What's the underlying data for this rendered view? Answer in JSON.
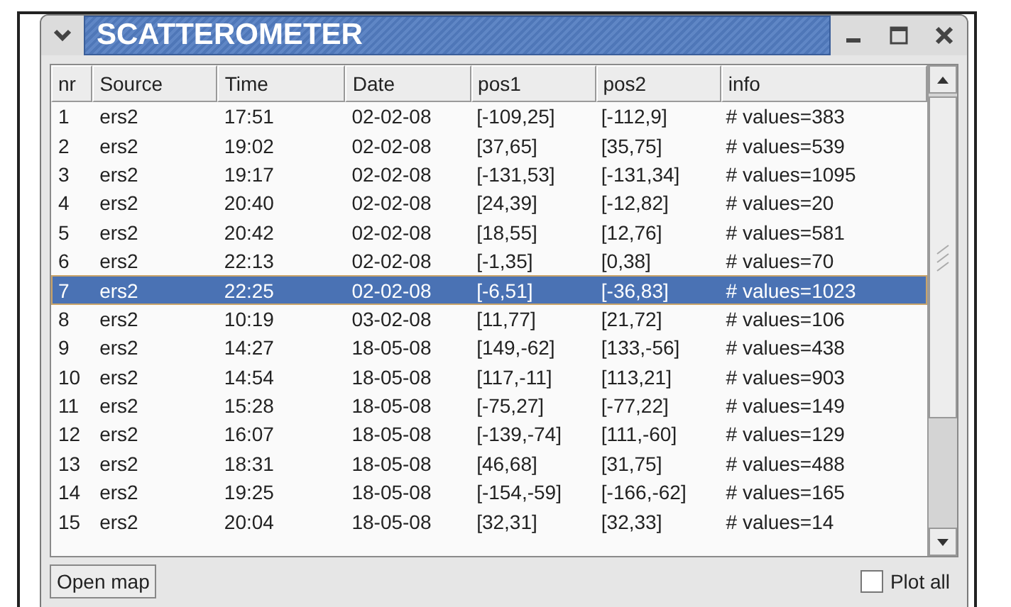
{
  "window": {
    "title": "SCATTEROMETER"
  },
  "table": {
    "columns": [
      "nr",
      "Source",
      "Time",
      "Date",
      "pos1",
      "pos2",
      "info"
    ],
    "rows": [
      {
        "cells": [
          "1",
          "ers2",
          "17:51",
          "02-02-08",
          "[-109,25]",
          "[-112,9]",
          "# values=383"
        ],
        "selected": false
      },
      {
        "cells": [
          "2",
          "ers2",
          "19:02",
          "02-02-08",
          "[37,65]",
          "[35,75]",
          "# values=539"
        ],
        "selected": false
      },
      {
        "cells": [
          "3",
          "ers2",
          "19:17",
          "02-02-08",
          "[-131,53]",
          "[-131,34]",
          "# values=1095"
        ],
        "selected": false
      },
      {
        "cells": [
          "4",
          "ers2",
          "20:40",
          "02-02-08",
          "[24,39]",
          "[-12,82]",
          "# values=20"
        ],
        "selected": false
      },
      {
        "cells": [
          "5",
          "ers2",
          "20:42",
          "02-02-08",
          "[18,55]",
          "[12,76]",
          "# values=581"
        ],
        "selected": false
      },
      {
        "cells": [
          "6",
          "ers2",
          "22:13",
          "02-02-08",
          "[-1,35]",
          "[0,38]",
          "# values=70"
        ],
        "selected": false
      },
      {
        "cells": [
          "7",
          "ers2",
          "22:25",
          "02-02-08",
          "[-6,51]",
          "[-36,83]",
          "# values=1023"
        ],
        "selected": true
      },
      {
        "cells": [
          "8",
          "ers2",
          "10:19",
          "03-02-08",
          "[11,77]",
          "[21,72]",
          "# values=106"
        ],
        "selected": false
      },
      {
        "cells": [
          "9",
          "ers2",
          "14:27",
          "18-05-08",
          "[149,-62]",
          "[133,-56]",
          "# values=438"
        ],
        "selected": false
      },
      {
        "cells": [
          "10",
          "ers2",
          "14:54",
          "18-05-08",
          "[117,-11]",
          "[113,21]",
          "# values=903"
        ],
        "selected": false
      },
      {
        "cells": [
          "11",
          "ers2",
          "15:28",
          "18-05-08",
          "[-75,27]",
          "[-77,22]",
          "# values=149"
        ],
        "selected": false
      },
      {
        "cells": [
          "12",
          "ers2",
          "16:07",
          "18-05-08",
          "[-139,-74]",
          "[111,-60]",
          "# values=129"
        ],
        "selected": false
      },
      {
        "cells": [
          "13",
          "ers2",
          "18:31",
          "18-05-08",
          "[46,68]",
          "[31,75]",
          "# values=488"
        ],
        "selected": false
      },
      {
        "cells": [
          "14",
          "ers2",
          "19:25",
          "18-05-08",
          "[-154,-59]",
          "[-166,-62]",
          "# values=165"
        ],
        "selected": false
      },
      {
        "cells": [
          "15",
          "ers2",
          "20:04",
          "18-05-08",
          "[32,31]",
          "[32,33]",
          "# values=14"
        ],
        "selected": false
      }
    ]
  },
  "buttons": {
    "open_map": "Open map"
  },
  "plot_all": {
    "label": "Plot all",
    "checked": false
  }
}
